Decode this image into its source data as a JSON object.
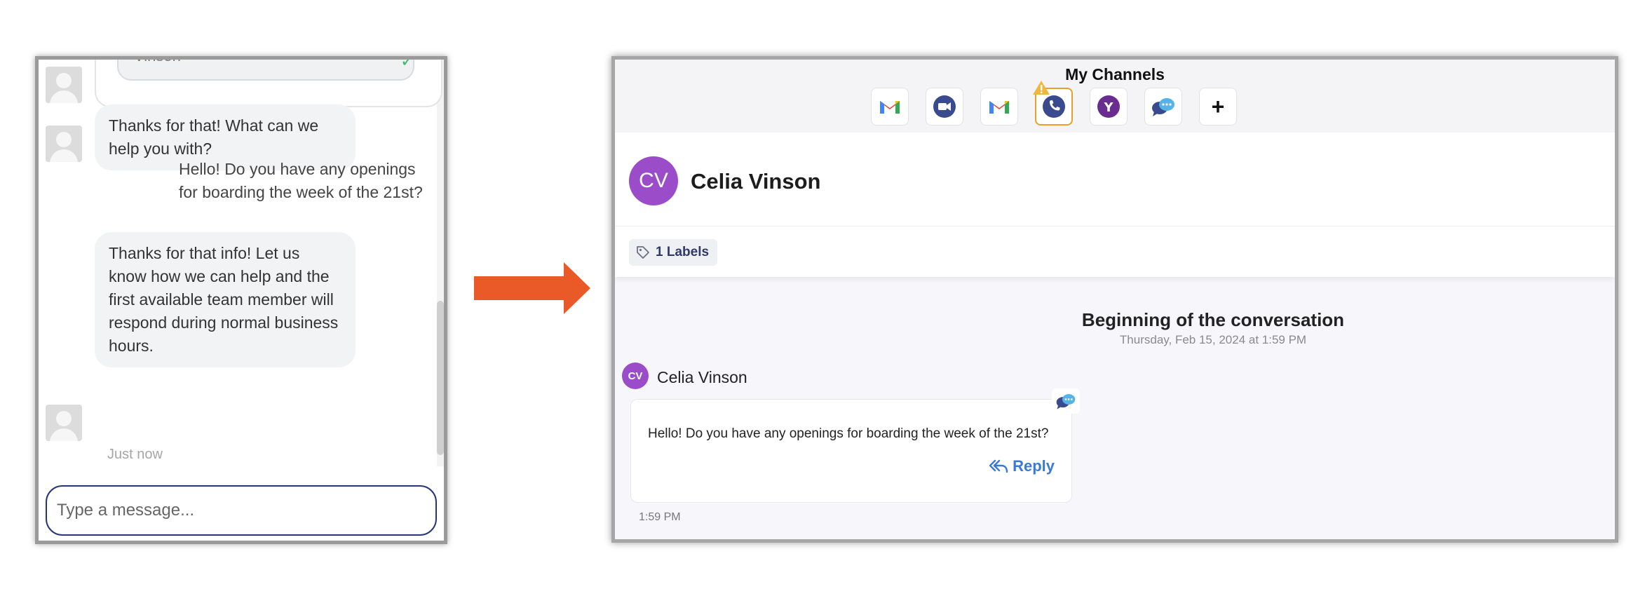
{
  "chat_widget": {
    "top_bubble_fragment": "Vinson",
    "messages": [
      {
        "from": "agent",
        "text": "Thanks for that! What can we help you with?"
      },
      {
        "from": "user",
        "text": "Hello! Do you have any openings for boarding the week of the 21st?"
      },
      {
        "from": "agent",
        "text": "Thanks for that info! Let us know how we can help and the first available team member will respond during normal business hours."
      }
    ],
    "timestamp": "Just now",
    "input_placeholder": "Type a message..."
  },
  "inbox": {
    "channels": {
      "title": "My Channels",
      "items": [
        {
          "icon": "gmail-icon"
        },
        {
          "icon": "video-call-icon"
        },
        {
          "icon": "gmail-icon"
        },
        {
          "icon": "phone-icon",
          "active": true,
          "warning": true
        },
        {
          "icon": "yahoo-icon"
        },
        {
          "icon": "webchat-icon"
        },
        {
          "icon": "plus-icon",
          "label": "+"
        }
      ]
    },
    "contact": {
      "initials": "CV",
      "name": "Celia Vinson",
      "avatar_color": "#9b4dc9"
    },
    "labels_chip": "1 Labels",
    "conversation": {
      "title": "Beginning of the conversation",
      "date": "Thursday, Feb 15, 2024 at 1:59 PM",
      "sender_initials": "CV",
      "sender_name": "Celia Vinson",
      "message": "Hello! Do you have any openings for boarding the week of the 21st?",
      "reply_label": "Reply",
      "time": "1:59 PM"
    }
  },
  "colors": {
    "arrow": "#ea5a28",
    "accent_blue": "#3b79d9",
    "input_border": "#27357e",
    "active_channel": "#e8a02a"
  }
}
